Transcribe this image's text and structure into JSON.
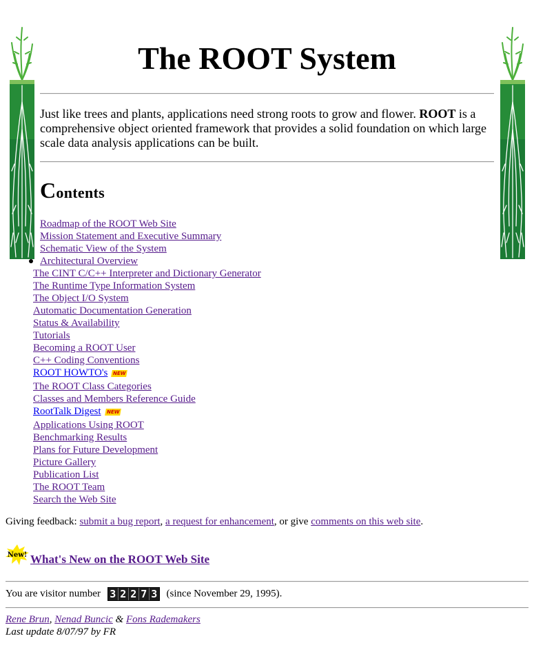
{
  "page": {
    "title": "The ROOT System",
    "intro_before": "Just like trees and plants, applications need strong roots to grow and flower. ",
    "intro_bold": "ROOT",
    "intro_after": " is a comprehensive object oriented framework that provides a solid foundation on which large scale data analysis applications can be built.",
    "contents_cap": "C",
    "contents_rest": "ontents"
  },
  "toc_top": [
    "Roadmap of the ROOT Web Site",
    "Mission Statement and Executive Summary",
    "Schematic View of the System"
  ],
  "toc": [
    "Architectural Overview",
    "The CINT C/C++ Interpreter and Dictionary Generator",
    "The Runtime Type Information System",
    "The Object I/O System",
    "Automatic Documentation Generation",
    "Status & Availability",
    "Tutorials",
    "Becoming a ROOT User",
    "C++ Coding Conventions",
    "ROOT HOWTO's",
    "The ROOT Class Categories",
    "Classes and Members Reference Guide",
    "RootTalk Digest",
    "Applications Using ROOT",
    "Benchmarking Results",
    "Plans for Future Development",
    "Picture Gallery",
    "Publication List",
    "The ROOT Team",
    "Search the Web Site"
  ],
  "badges": {
    "new": "NEW",
    "new_icon": "New!"
  },
  "feedback": {
    "prefix": "Giving feedback: ",
    "bug_link": "submit a bug report",
    "comma": ", ",
    "enh_link": "a request for enhancement",
    "or_give": ", or give ",
    "comments_link": "comments on this web site",
    "period": "."
  },
  "whats_new": "What's New on the ROOT Web Site",
  "visitor": {
    "prefix": "You are visitor number",
    "digits": [
      "3",
      "2",
      "2",
      "7",
      "3"
    ],
    "suffix": "(since November 29, 1995)."
  },
  "authors": {
    "a1": "Rene Brun",
    "sep1": ", ",
    "a2": "Nenad Buncic",
    "amp": " & ",
    "a3": "Fons Rademakers",
    "last_update": "Last update 8/07/97 by FR"
  },
  "colors": {
    "visited_link": "#551a8b",
    "link": "#0000ee",
    "plant_leaf": "#2e9c2e",
    "plant_root": "#0f6e2a",
    "badge_yellow": "#ffd400"
  },
  "icons": {
    "plant": "root-plant-icon",
    "new_star": "new-star-icon",
    "counter": "visitor-counter"
  }
}
